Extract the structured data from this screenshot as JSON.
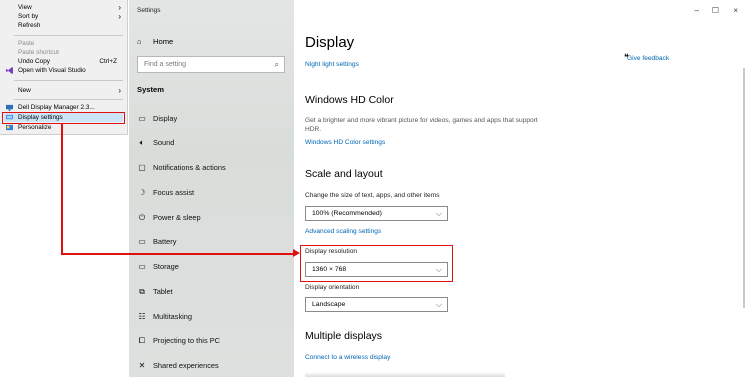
{
  "context_menu": {
    "view": "View",
    "sort_by": "Sort by",
    "refresh": "Refresh",
    "paste": "Paste",
    "paste_shortcut": "Paste shortcut",
    "undo_copy": "Undo Copy",
    "undo_shortcut": "Ctrl+Z",
    "open_vs": "Open with Visual Studio",
    "new": "New",
    "dell": "Dell Display Manager 2.3...",
    "display_settings": "Display settings",
    "personalize": "Personalize"
  },
  "window": {
    "title": "Settings",
    "home": "Home",
    "search_placeholder": "Find a setting",
    "section": "System",
    "nav": [
      "Display",
      "Sound",
      "Notifications & actions",
      "Focus assist",
      "Power & sleep",
      "Battery",
      "Storage",
      "Tablet",
      "Multitasking",
      "Projecting to this PC",
      "Shared experiences"
    ],
    "controls": {
      "minimize": "–",
      "maximize": "☐",
      "close": "×"
    }
  },
  "display": {
    "title": "Display",
    "night_light": "Night light settings",
    "give_feedback": "Give feedback",
    "hd_title": "Windows HD Color",
    "hd_desc": "Get a brighter and more vibrant picture for videos, games and apps that support HDR.",
    "hd_link": "Windows HD Color settings",
    "scale_title": "Scale and layout",
    "scale_label": "Change the size of text, apps, and other items",
    "scale_value": "100% (Recommended)",
    "advanced_scaling": "Advanced scaling settings",
    "resolution_label": "Display resolution",
    "resolution_value": "1360 × 768",
    "orientation_label": "Display orientation",
    "orientation_value": "Landscape",
    "multi_title": "Multiple displays",
    "connect_wireless": "Connect to a wireless display"
  },
  "colors": {
    "accent": "#0066b4",
    "annotation": "#e01010"
  }
}
